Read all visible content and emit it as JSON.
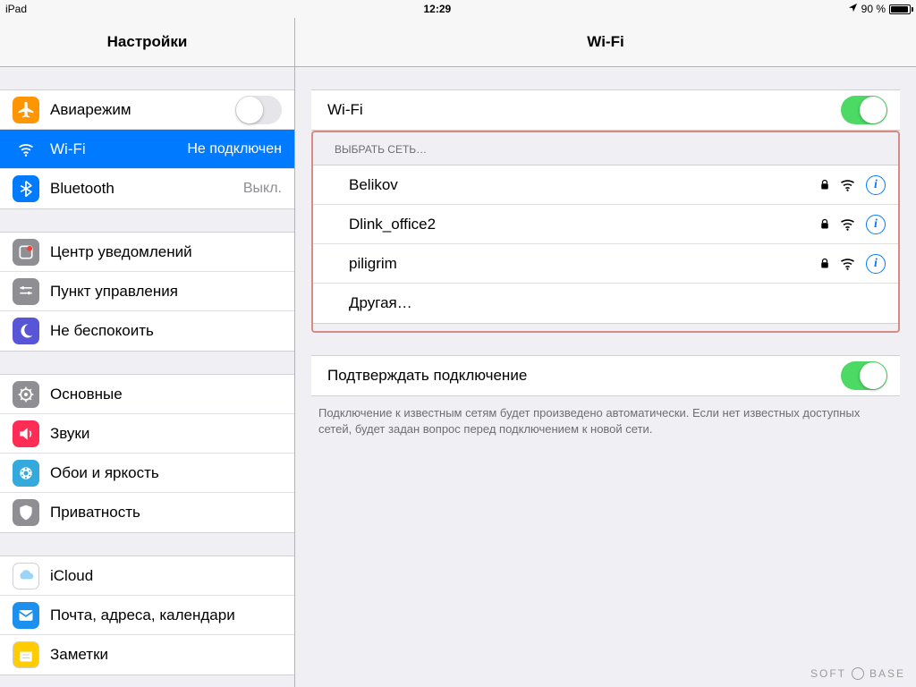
{
  "status": {
    "device": "iPad",
    "time": "12:29",
    "battery_pct": "90 %"
  },
  "sidebar": {
    "title": "Настройки",
    "groups": [
      [
        {
          "key": "airplane",
          "label": "Авиарежим",
          "iconBG": "#ff9500",
          "toggle": "off"
        },
        {
          "key": "wifi",
          "label": "Wi-Fi",
          "iconBG": "#007aff",
          "detail": "Не подключен",
          "selected": true
        },
        {
          "key": "bluetooth",
          "label": "Bluetooth",
          "iconBG": "#007aff",
          "detail": "Выкл."
        }
      ],
      [
        {
          "key": "notif",
          "label": "Центр уведомлений",
          "iconBG": "#8e8e93"
        },
        {
          "key": "control",
          "label": "Пункт управления",
          "iconBG": "#8e8e93"
        },
        {
          "key": "dnd",
          "label": "Не беспокоить",
          "iconBG": "#5856d6"
        }
      ],
      [
        {
          "key": "general",
          "label": "Основные",
          "iconBG": "#8e8e93"
        },
        {
          "key": "sounds",
          "label": "Звуки",
          "iconBG": "#ff2d55"
        },
        {
          "key": "wallpaper",
          "label": "Обои и яркость",
          "iconBG": "#34aadc"
        },
        {
          "key": "privacy",
          "label": "Приватность",
          "iconBG": "#8e8e93"
        }
      ],
      [
        {
          "key": "icloud",
          "label": "iCloud",
          "iconBG": "#ffffff"
        },
        {
          "key": "mail",
          "label": "Почта, адреса, календари",
          "iconBG": "#1b90ef"
        },
        {
          "key": "notes",
          "label": "Заметки",
          "iconBG": "#ffcc00"
        }
      ]
    ]
  },
  "detail": {
    "title": "Wi-Fi",
    "wifi": {
      "label": "Wi-Fi",
      "on": true
    },
    "choose_label": "ВЫБРАТЬ СЕТЬ…",
    "networks": [
      {
        "name": "Belikov",
        "locked": true
      },
      {
        "name": "Dlink_office2",
        "locked": true
      },
      {
        "name": "piligrim",
        "locked": true
      }
    ],
    "other_label": "Другая…",
    "ask": {
      "label": "Подтверждать подключение",
      "on": true
    },
    "ask_hint": "Подключение к известным сетям будет произведено автоматически. Если нет известных доступных сетей, будет задан вопрос перед подключением к новой сети."
  },
  "watermark": {
    "left": "SOFT",
    "right": "BASE"
  }
}
